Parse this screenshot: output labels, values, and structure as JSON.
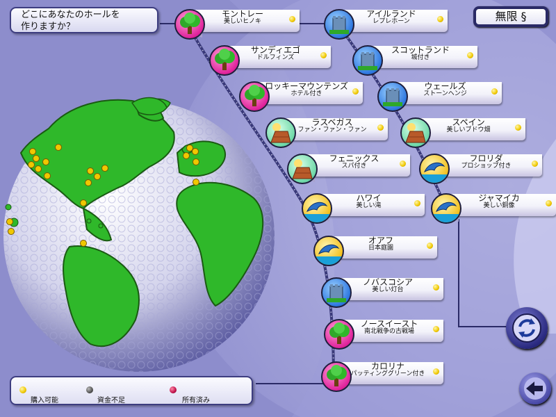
{
  "prompt": {
    "line1": "どこにあなたのホールを",
    "line2": "作りますか？"
  },
  "counter": {
    "value": "無限 §"
  },
  "courses_left": [
    {
      "name": "モントレー",
      "sub": "美しいヒノキ",
      "icon": "tree-icon",
      "status": "available"
    },
    {
      "name": "サンディエゴ",
      "sub": "ドルフィンズ",
      "icon": "tree-icon",
      "status": "available"
    },
    {
      "name": "ロッキーマウンテンズ",
      "sub": "ホテル付き",
      "icon": "tree-icon",
      "status": "available"
    },
    {
      "name": "ラスベガス",
      "sub": "ファン・ファン・ファン",
      "icon": "mesa-icon",
      "status": "available"
    },
    {
      "name": "フェニックス",
      "sub": "スパ付き",
      "icon": "mesa-icon",
      "status": "available"
    },
    {
      "name": "ハワイ",
      "sub": "美しい滝",
      "icon": "dolphin-icon",
      "status": "available"
    },
    {
      "name": "オアフ",
      "sub": "日本庭園",
      "icon": "dolphin-icon",
      "status": "available"
    },
    {
      "name": "ノバスコシア",
      "sub": "美しい灯台",
      "icon": "castle-icon",
      "status": "available"
    },
    {
      "name": "ノースイースト",
      "sub": "南北戦争の古戦場",
      "icon": "tree-icon",
      "status": "available"
    },
    {
      "name": "カロリナ",
      "sub": "パッティンググリーン付き",
      "icon": "tree-icon",
      "status": "available"
    }
  ],
  "courses_right": [
    {
      "name": "アイルランド",
      "sub": "レプレホーン",
      "icon": "castle-icon",
      "status": "available"
    },
    {
      "name": "スコットランド",
      "sub": "城付き",
      "icon": "castle-icon",
      "status": "available"
    },
    {
      "name": "ウェールズ",
      "sub": "ストーンヘンジ",
      "icon": "castle-icon",
      "status": "available"
    },
    {
      "name": "スペイン",
      "sub": "美しいブドウ畑",
      "icon": "mesa-icon",
      "status": "available"
    },
    {
      "name": "フロリダ",
      "sub": "プロショップ付き",
      "icon": "dolphin-icon",
      "status": "available"
    },
    {
      "name": "ジャマイカ",
      "sub": "美しい銅像",
      "icon": "dolphin-icon",
      "status": "available"
    }
  ],
  "legend": {
    "available": {
      "label": "購入可能",
      "color": "#f0c800"
    },
    "insufficient": {
      "label": "資金不足",
      "color": "#555555"
    },
    "owned": {
      "label": "所有済み",
      "color": "#c0104a"
    }
  },
  "colors": {
    "background": "#8f8fce",
    "ocean": "#ffffff",
    "land": "#2fb82a",
    "accent_dot": "#f0c800"
  }
}
